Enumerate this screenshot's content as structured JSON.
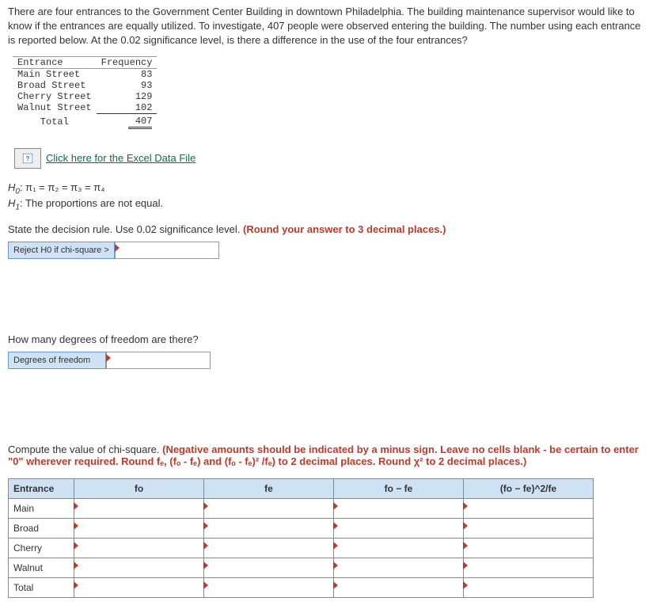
{
  "intro": "There are four entrances to the Government Center Building in downtown Philadelphia. The building maintenance supervisor would like to know if the entrances are equally utilized. To investigate, 407 people were observed entering the building. The number using each entrance is reported below. At the 0.02 significance level, is there a difference in the use of the four entrances?",
  "freq_table": {
    "headers": [
      "Entrance",
      "Frequency"
    ],
    "rows": [
      {
        "name": "Main Street",
        "freq": "83"
      },
      {
        "name": "Broad Street",
        "freq": "93"
      },
      {
        "name": "Cherry Street",
        "freq": "129"
      },
      {
        "name": "Walnut Street",
        "freq": "102"
      }
    ],
    "total_label": "Total",
    "total_value": "407"
  },
  "excel_link": "Click here for the Excel Data File",
  "h0_prefix": "H",
  "h0_sub": "0",
  "h0_body": ": π₁ = π₂ = π₃ = π₄",
  "h1_prefix": "H",
  "h1_sub": "1",
  "h1_body": ": The proportions are not equal.",
  "decision_rule_text": "State the decision rule. Use 0.02 significance level. ",
  "decision_rule_red": "(Round your answer to 3 decimal places.)",
  "reject_label": "Reject H0 if chi-square >",
  "df_question": "How many degrees of freedom are there?",
  "df_label": "Degrees of freedom",
  "chi_instr_plain": "Compute the value of chi-square. ",
  "chi_instr_red": "(Negative amounts should be indicated by a minus sign. Leave no cells blank - be certain to enter \"0\" wherever required. Round fₑ, (fₒ - fₑ) and (fₒ - fₑ)² /fₑ) to 2 decimal places. Round χ² to 2 decimal places.)",
  "chi_table": {
    "headers": [
      "Entrance",
      "fo",
      "fe",
      "fo − fe",
      "(fo − fe)^2/fe"
    ],
    "rows": [
      "Main",
      "Broad",
      "Cherry",
      "Walnut",
      "Total"
    ]
  }
}
